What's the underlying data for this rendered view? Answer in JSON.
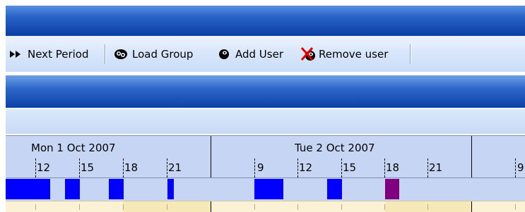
{
  "toolbar": {
    "next_period_label": "Next Period",
    "load_group_label": "Load Group",
    "add_user_label": "Add User",
    "remove_user_label": "Remove user"
  },
  "timeline": {
    "days": [
      {
        "label": "Mon 1 Oct 2007"
      },
      {
        "label": "Tue 2 Oct 2007"
      }
    ],
    "hours": [
      "12",
      "15",
      "18",
      "21",
      "9",
      "12",
      "15",
      "18",
      "21",
      "9"
    ],
    "booking_colors": {
      "default": "#0000ff",
      "highlight": "#800080"
    }
  }
}
